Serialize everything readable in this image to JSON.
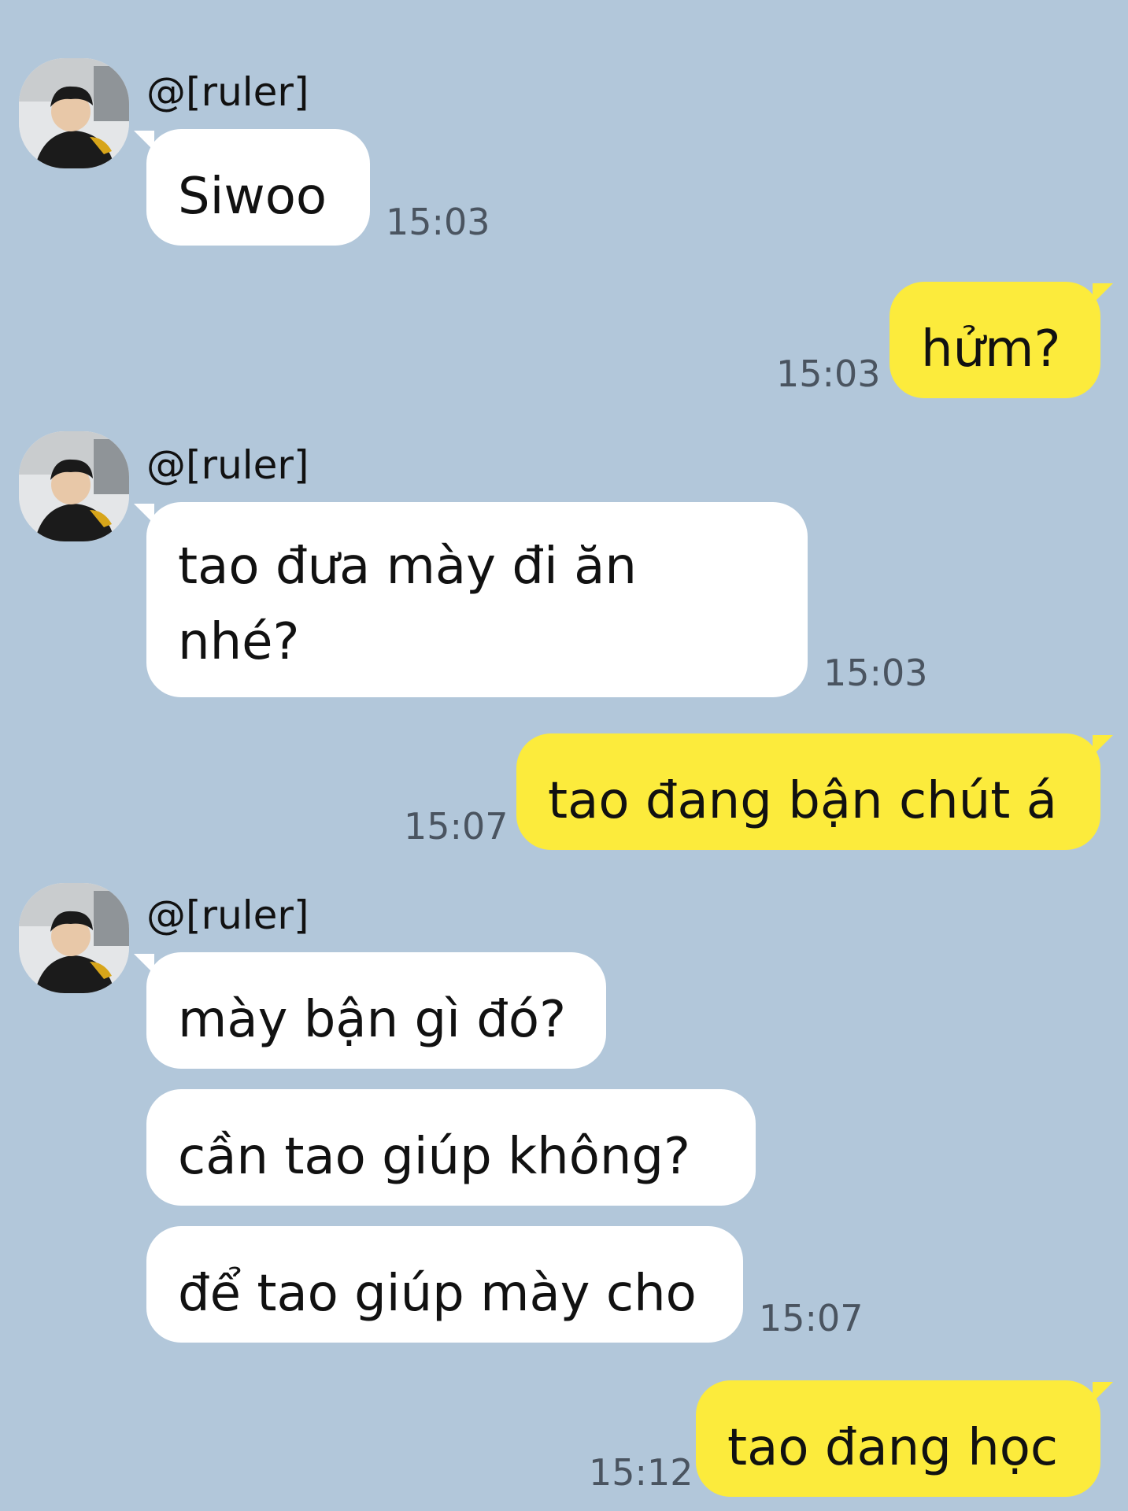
{
  "chat": {
    "sender_name": "@[ruler]",
    "messages": [
      {
        "from": "them",
        "text": "Siwoo",
        "time": "15:03"
      },
      {
        "from": "me",
        "text": "hửm?",
        "time": "15:03"
      },
      {
        "from": "them",
        "line1": "tao đưa mày đi ăn",
        "line2": "nhé?",
        "time": "15:03"
      },
      {
        "from": "me",
        "text": "tao đang bận chút á",
        "time": "15:07"
      },
      {
        "from": "them",
        "text": "mày bận gì đó?"
      },
      {
        "from": "them",
        "text": "cần tao giúp không?"
      },
      {
        "from": "them",
        "text": "để tao giúp mày cho",
        "time": "15:07"
      },
      {
        "from": "me",
        "text": "tao đang học",
        "time": "15:12"
      }
    ]
  },
  "colors": {
    "background": "#b2c7da",
    "incoming_bubble": "#ffffff",
    "outgoing_bubble": "#fceb3c",
    "timestamp": "#4a5460"
  }
}
